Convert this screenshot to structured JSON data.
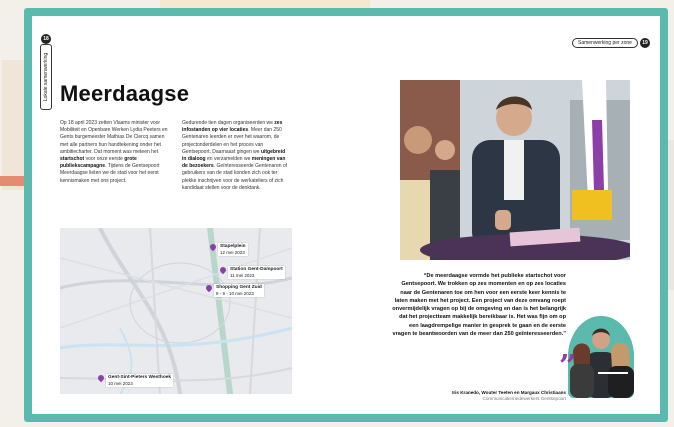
{
  "side_tab": {
    "label": "Lokale samenwerking",
    "number": "18"
  },
  "header": {
    "pill": "Samenwerking per zone",
    "page_number": "19"
  },
  "title": "Meerdaagse",
  "col1": [
    {
      "t": "Op 18 april 2023 zetten Vlaams minister voor Mobiliteit en Openbare Werken Lydia Peeters en Gents burgemeester Mathias De Clercq samen met alle partners hun handtekening onder het ambitiecharter. Dat moment was meteen het ",
      "b": false
    },
    {
      "t": "startschot",
      "b": true
    },
    {
      "t": " voor onze eerste ",
      "b": false
    },
    {
      "t": "grote publiekscampagne",
      "b": true
    },
    {
      "t": ". Tijdens de Gentsepoort Meerdaagse lieten we de stad voor het eerst kennismaken met ons project.",
      "b": false
    }
  ],
  "col2": [
    {
      "t": "Gedurende tien dagen organiseerden we ",
      "b": false
    },
    {
      "t": "zes infostanden op vier locaties",
      "b": true
    },
    {
      "t": ". Meer dan 250 Gentenaren leerden er over het waarom, de projectonderdelen en het proces van Gentsepoort. Daarnaast gingen we ",
      "b": false
    },
    {
      "t": "uitgebreid in dialoog",
      "b": true
    },
    {
      "t": " en verzamelden we ",
      "b": false
    },
    {
      "t": "meningen van de bezoekers",
      "b": true
    },
    {
      "t": ". Geïnteresseerde Gentenaren of gebruikers van de stad konden zich ook ter plekke inschrijven voor de werkateliers of zich kandidaat stellen voor de denktank.",
      "b": false
    }
  ],
  "map": {
    "pins": [
      {
        "name": "Stapelplein",
        "date": "12 mei 2023"
      },
      {
        "name": "Station Gent-Dampoort",
        "date": "11 mei 2023"
      },
      {
        "name": "Shopping Gent Zuid",
        "date": "8 - 9 - 10 mei 2023"
      },
      {
        "name": "Gent-Sint-Pieters Westhoek",
        "date": "10 mei 2023"
      }
    ]
  },
  "quote": {
    "text": "“De meerdaagse vormde het publieke startschot voor Gentsepoort. We trokken op zes momenten en op zes locaties naar de Gentenaren toe om hen voor een eerste keer kennis te laten maken met het project. Een project van deze omvang roept onvermijdelijk vragen op bij de omgeving en dan is het belangrijk dat het projectteam makkelijk bereikbaar is. Het was fijn om op een laagdrempelige manier in gesprek te gaan en de eerste vragen te beantwoorden van de meer dan 250 geïnteresseerden.”",
    "names": "Iris Kranedo, Wouter Teeten en Margaux Christiaans",
    "role": "Communicatiemedewerkers Gentsepoort"
  },
  "colors": {
    "teal": "#5bb9ad",
    "purple": "#8c3fa6"
  },
  "icons": [
    "quote-mark-icon",
    "map-pin-icon"
  ]
}
